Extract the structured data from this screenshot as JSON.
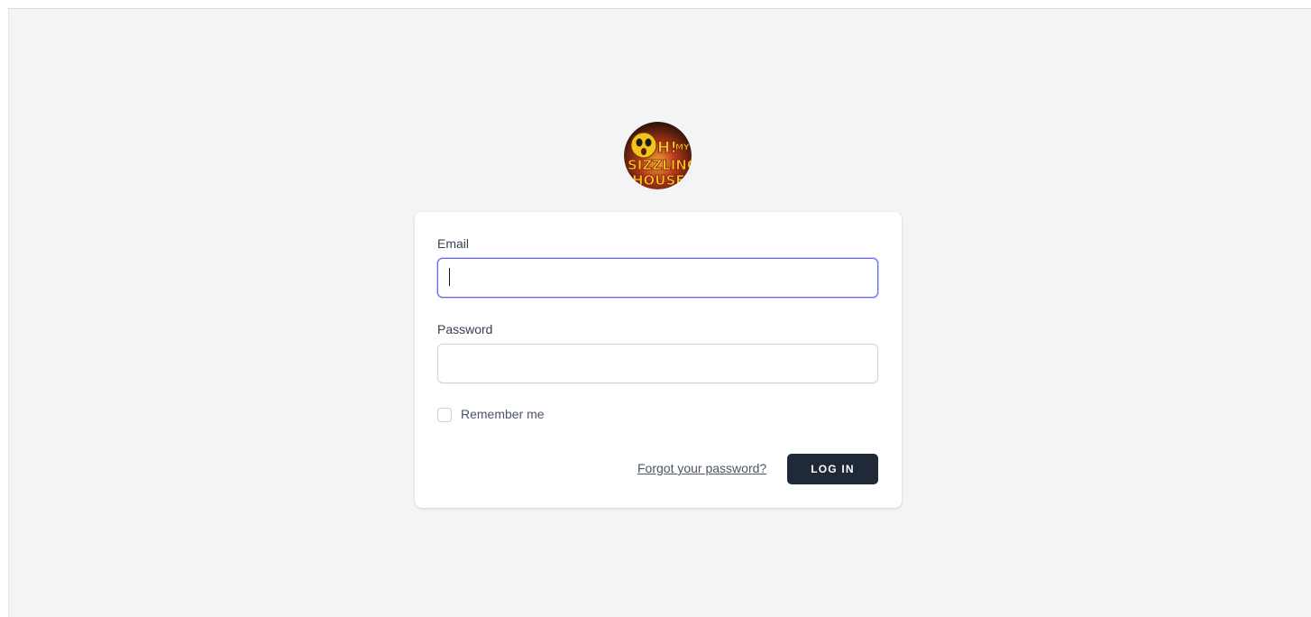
{
  "logo": {
    "icon": "oh-my-sizzling-house-logo",
    "text": "OH MY SIZZLING HOUSE"
  },
  "form": {
    "email_label": "Email",
    "email_value": "",
    "password_label": "Password",
    "password_value": "",
    "remember_label": "Remember me",
    "remember_checked": false,
    "forgot_link": "Forgot your password?",
    "login_button": "LOG IN"
  },
  "colors": {
    "page_background": "#f3f4f6",
    "card_background": "#ffffff",
    "focus_ring": "#6366f1",
    "button_background": "#1f2937",
    "button_text": "#ffffff"
  }
}
